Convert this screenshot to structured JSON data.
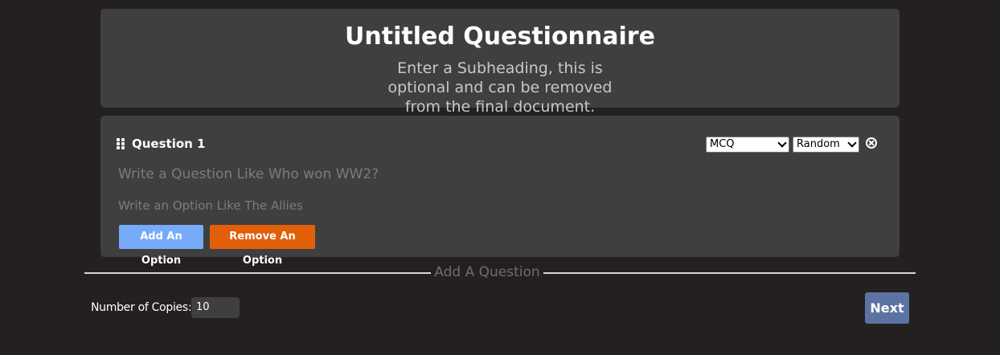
{
  "header": {
    "title": "Untitled Questionnaire",
    "subheading": "Enter a Subheading, this is optional and can be removed from the final document."
  },
  "question": {
    "label": "Question 1",
    "type_select": {
      "value": "MCQ"
    },
    "order_select": {
      "value": "Random"
    },
    "question_placeholder": "Write a Question Like Who won WW2?",
    "option_placeholder": "Write an Option Like The Allies",
    "add_option_label": "Add An Option",
    "remove_option_label": "Remove An Option",
    "icons": {
      "drag": "drag-handle-icon",
      "remove": "close-circle-icon"
    }
  },
  "add_question_label": "Add A Question",
  "footer": {
    "copies_label": "Number of Copies:",
    "copies_value": "10",
    "next_label": "Next"
  },
  "colors": {
    "background": "#242020",
    "card": "#3f3f3f",
    "add_button": "#77aaf8",
    "remove_button": "#e25f0a",
    "next_button": "#5a73a3"
  }
}
